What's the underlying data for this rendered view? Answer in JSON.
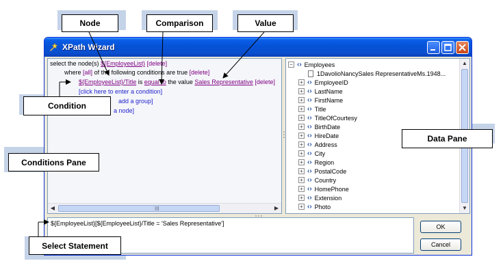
{
  "callouts": {
    "node": "Node",
    "comparison": "Comparison",
    "value": "Value",
    "condition": "Condition",
    "conditions_pane": "Conditions Pane",
    "data_pane": "Data Pane",
    "select_statement": "Select Statement"
  },
  "window": {
    "title": "XPath Wizard"
  },
  "conditions": {
    "line1_prefix": "select the node(s)",
    "line1_node": "${EmployeeList}",
    "line1_delete": "[delete]",
    "line2_prefix": "where",
    "line2_all": "[all]",
    "line2_middle": "of the following conditions are true",
    "line2_delete": "[delete]",
    "line3_node": "${EmployeeList}/Title",
    "line3_is": "is",
    "line3_comparison": "equal to",
    "line3_the_value": "the value",
    "line3_value": "Sales Representative",
    "line3_delete": "[delete]",
    "line4": "[click here to enter a condition]",
    "line5": "add a group]",
    "line6": "a node]"
  },
  "tree": {
    "root": "Employees",
    "record": "1DavolioNancySales RepresentativeMs.1948...",
    "fields": [
      "EmployeeID",
      "LastName",
      "FirstName",
      "Title",
      "TitleOfCourtesy",
      "BirthDate",
      "HireDate",
      "Address",
      "City",
      "Region",
      "PostalCode",
      "Country",
      "HomePhone",
      "Extension",
      "Photo"
    ]
  },
  "select_statement": "${EmployeeList}[${EmployeeList}/Title = 'Sales Representative']",
  "buttons": {
    "ok": "OK",
    "cancel": "Cancel"
  },
  "scrollbar": {
    "grip": "III"
  }
}
